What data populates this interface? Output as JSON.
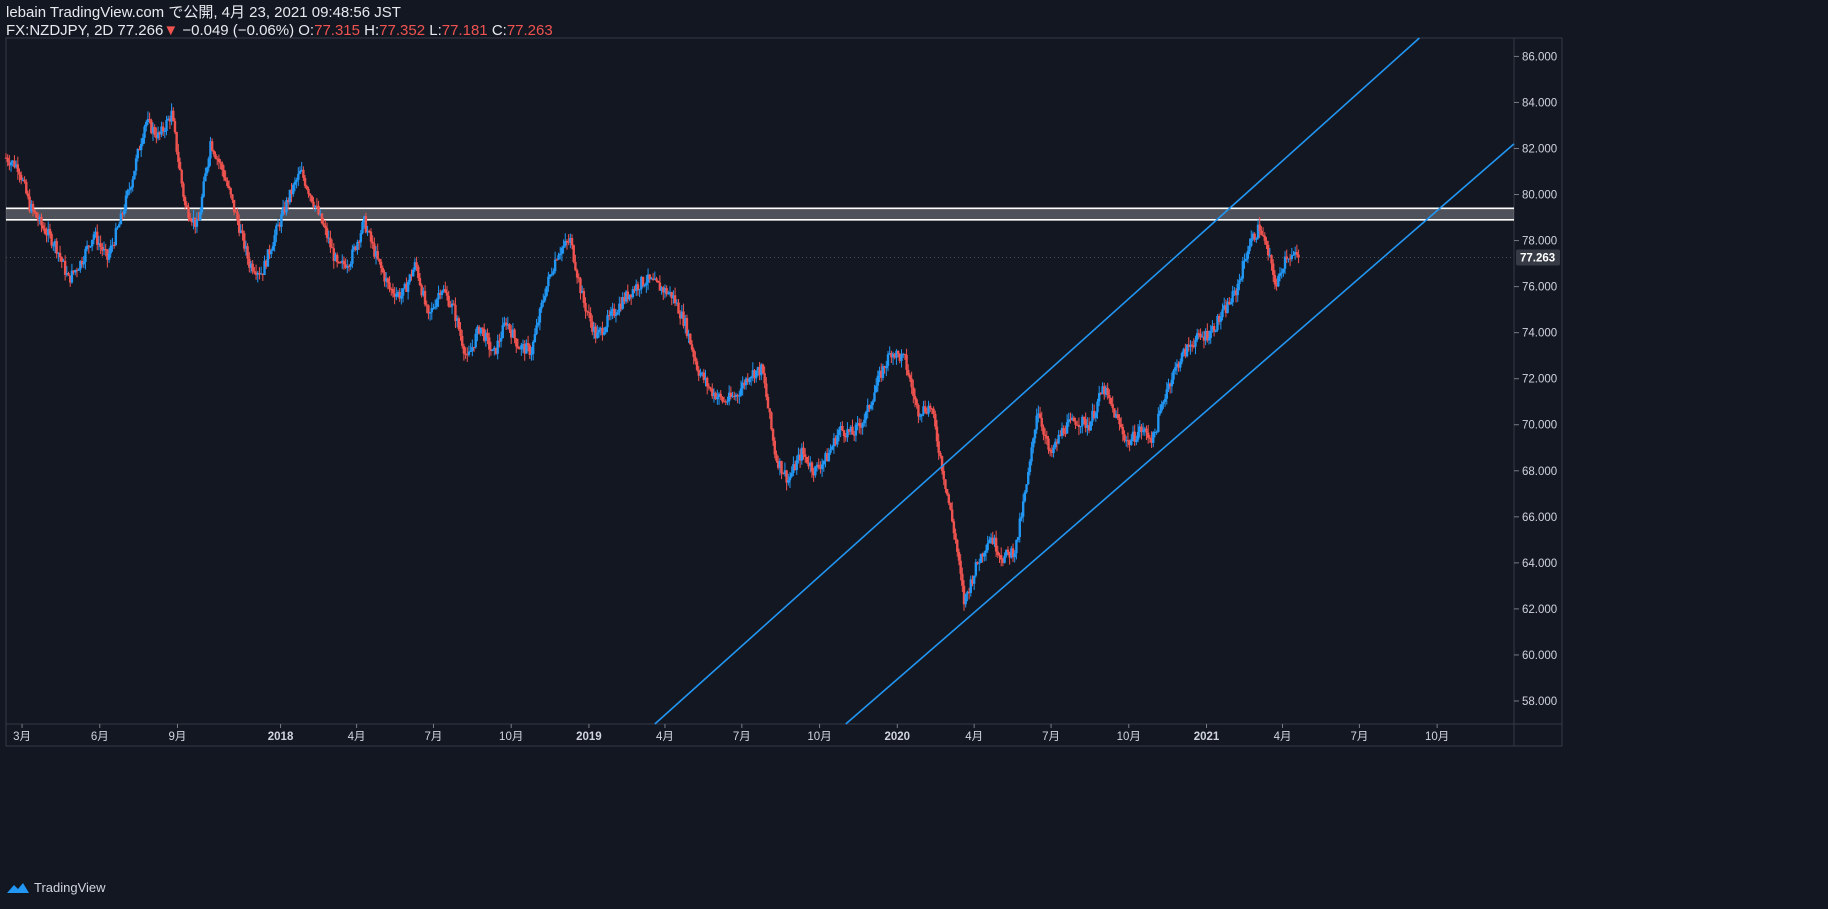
{
  "header": {
    "published_line": "lebain TradingView.com で公開, 4月 23, 2021 09:48:56 JST",
    "symbol": "FX:NZDJPY, 2D",
    "last": "77.266",
    "change_arrow": "▼",
    "change": "−0.049 (−0.06%)",
    "o_label": "O:",
    "o_value": "77.315",
    "h_label": "H:",
    "h_value": "77.352",
    "l_label": "L:",
    "l_value": "77.181",
    "c_label": "C:",
    "c_value": "77.263"
  },
  "footer": {
    "brand": "TradingView"
  },
  "colors": {
    "background": "#131722",
    "up": "#2196f3",
    "down": "#ef5350",
    "channel": "#2196f3",
    "zone": "#ffffff",
    "grid_border": "#363a45",
    "text": "#d1d4dc"
  },
  "chart_data": {
    "type": "candlestick",
    "symbol": "FX:NZDJPY",
    "timeframe": "2D",
    "ylim": [
      57,
      86.8
    ],
    "x_range": [
      "2017-02-10",
      "2021-12-31"
    ],
    "y_ticks": [
      "58.000",
      "60.000",
      "62.000",
      "64.000",
      "66.000",
      "68.000",
      "70.000",
      "72.000",
      "74.000",
      "76.000",
      "78.000",
      "80.000",
      "82.000",
      "84.000",
      "86.000"
    ],
    "x_ticks": [
      {
        "label": "3月",
        "date": "2017-03-01"
      },
      {
        "label": "6月",
        "date": "2017-06-01"
      },
      {
        "label": "9月",
        "date": "2017-09-01"
      },
      {
        "label": "2018",
        "date": "2018-01-01"
      },
      {
        "label": "4月",
        "date": "2018-04-01"
      },
      {
        "label": "7月",
        "date": "2018-07-01"
      },
      {
        "label": "10月",
        "date": "2018-10-01"
      },
      {
        "label": "2019",
        "date": "2019-01-01"
      },
      {
        "label": "4月",
        "date": "2019-04-01"
      },
      {
        "label": "7月",
        "date": "2019-07-01"
      },
      {
        "label": "10月",
        "date": "2019-10-01"
      },
      {
        "label": "2020",
        "date": "2020-01-01"
      },
      {
        "label": "4月",
        "date": "2020-04-01"
      },
      {
        "label": "7月",
        "date": "2020-07-01"
      },
      {
        "label": "10月",
        "date": "2020-10-01"
      },
      {
        "label": "2021",
        "date": "2021-01-01"
      },
      {
        "label": "4月",
        "date": "2021-04-01"
      },
      {
        "label": "7月",
        "date": "2021-07-01"
      },
      {
        "label": "10月",
        "date": "2021-10-01"
      }
    ],
    "last_price_label": "77.263",
    "last_price": 77.263,
    "close_path": [
      [
        "2017-02-10",
        81.6
      ],
      [
        "2017-02-25",
        81.2
      ],
      [
        "2017-03-10",
        79.5
      ],
      [
        "2017-03-25",
        78.6
      ],
      [
        "2017-04-10",
        77.8
      ],
      [
        "2017-04-25",
        76.3
      ],
      [
        "2017-05-10",
        77.1
      ],
      [
        "2017-05-25",
        78.3
      ],
      [
        "2017-06-10",
        77.2
      ],
      [
        "2017-06-25",
        78.8
      ],
      [
        "2017-07-10",
        80.8
      ],
      [
        "2017-07-25",
        83.2
      ],
      [
        "2017-08-10",
        82.5
      ],
      [
        "2017-08-25",
        83.5
      ],
      [
        "2017-09-10",
        79.5
      ],
      [
        "2017-09-25",
        78.6
      ],
      [
        "2017-10-10",
        82.3
      ],
      [
        "2017-10-25",
        81.0
      ],
      [
        "2017-11-10",
        79.0
      ],
      [
        "2017-11-25",
        77.0
      ],
      [
        "2017-12-10",
        76.6
      ],
      [
        "2017-12-25",
        78.2
      ],
      [
        "2018-01-10",
        79.8
      ],
      [
        "2018-01-25",
        81.0
      ],
      [
        "2018-02-10",
        79.6
      ],
      [
        "2018-02-25",
        78.2
      ],
      [
        "2018-03-10",
        76.8
      ],
      [
        "2018-03-25",
        77.2
      ],
      [
        "2018-04-10",
        78.8
      ],
      [
        "2018-04-25",
        77.2
      ],
      [
        "2018-05-10",
        75.9
      ],
      [
        "2018-05-25",
        75.6
      ],
      [
        "2018-06-10",
        77.0
      ],
      [
        "2018-06-25",
        74.6
      ],
      [
        "2018-07-10",
        76.0
      ],
      [
        "2018-07-25",
        75.0
      ],
      [
        "2018-08-10",
        72.8
      ],
      [
        "2018-08-25",
        74.3
      ],
      [
        "2018-09-10",
        73.0
      ],
      [
        "2018-09-25",
        74.5
      ],
      [
        "2018-10-10",
        73.4
      ],
      [
        "2018-10-25",
        73.2
      ],
      [
        "2018-11-10",
        75.8
      ],
      [
        "2018-11-25",
        77.5
      ],
      [
        "2018-12-10",
        78.0
      ],
      [
        "2018-12-25",
        75.4
      ],
      [
        "2019-01-10",
        73.8
      ],
      [
        "2019-01-25",
        74.6
      ],
      [
        "2019-02-10",
        75.4
      ],
      [
        "2019-02-25",
        76.0
      ],
      [
        "2019-03-10",
        76.3
      ],
      [
        "2019-03-25",
        76.0
      ],
      [
        "2019-04-10",
        75.6
      ],
      [
        "2019-04-25",
        74.4
      ],
      [
        "2019-05-10",
        72.4
      ],
      [
        "2019-05-25",
        71.5
      ],
      [
        "2019-06-10",
        71.0
      ],
      [
        "2019-06-25",
        71.3
      ],
      [
        "2019-07-10",
        72.2
      ],
      [
        "2019-07-25",
        72.4
      ],
      [
        "2019-08-10",
        68.6
      ],
      [
        "2019-08-25",
        67.6
      ],
      [
        "2019-09-10",
        68.8
      ],
      [
        "2019-09-25",
        68.0
      ],
      [
        "2019-10-10",
        68.6
      ],
      [
        "2019-10-25",
        69.8
      ],
      [
        "2019-11-10",
        69.6
      ],
      [
        "2019-11-25",
        70.4
      ],
      [
        "2019-12-10",
        72.0
      ],
      [
        "2019-12-25",
        73.2
      ],
      [
        "2020-01-10",
        72.8
      ],
      [
        "2020-01-25",
        70.6
      ],
      [
        "2020-02-10",
        70.8
      ],
      [
        "2020-02-25",
        67.8
      ],
      [
        "2020-03-10",
        65.0
      ],
      [
        "2020-03-20",
        62.3
      ],
      [
        "2020-04-05",
        64.0
      ],
      [
        "2020-04-20",
        65.2
      ],
      [
        "2020-05-05",
        64.2
      ],
      [
        "2020-05-20",
        64.6
      ],
      [
        "2020-06-05",
        68.0
      ],
      [
        "2020-06-15",
        70.8
      ],
      [
        "2020-06-30",
        68.6
      ],
      [
        "2020-07-15",
        69.8
      ],
      [
        "2020-07-30",
        70.2
      ],
      [
        "2020-08-15",
        70.0
      ],
      [
        "2020-09-01",
        71.6
      ],
      [
        "2020-09-15",
        70.4
      ],
      [
        "2020-09-30",
        69.2
      ],
      [
        "2020-10-15",
        69.8
      ],
      [
        "2020-10-30",
        69.4
      ],
      [
        "2020-11-15",
        71.6
      ],
      [
        "2020-11-30",
        72.8
      ],
      [
        "2020-12-15",
        73.6
      ],
      [
        "2021-01-05",
        74.0
      ],
      [
        "2021-01-20",
        74.8
      ],
      [
        "2021-02-05",
        75.8
      ],
      [
        "2021-02-20",
        77.8
      ],
      [
        "2021-03-05",
        78.6
      ],
      [
        "2021-03-15",
        77.4
      ],
      [
        "2021-03-25",
        76.0
      ],
      [
        "2021-04-05",
        77.4
      ],
      [
        "2021-04-20",
        77.26
      ]
    ],
    "zone": {
      "top": 79.4,
      "bottom": 78.9
    },
    "channel_upper": [
      [
        "2019-03-20",
        57.0
      ],
      [
        "2021-09-10",
        86.8
      ]
    ],
    "channel_lower": [
      [
        "2019-11-01",
        57.0
      ],
      [
        "2021-12-31",
        82.2
      ]
    ]
  }
}
